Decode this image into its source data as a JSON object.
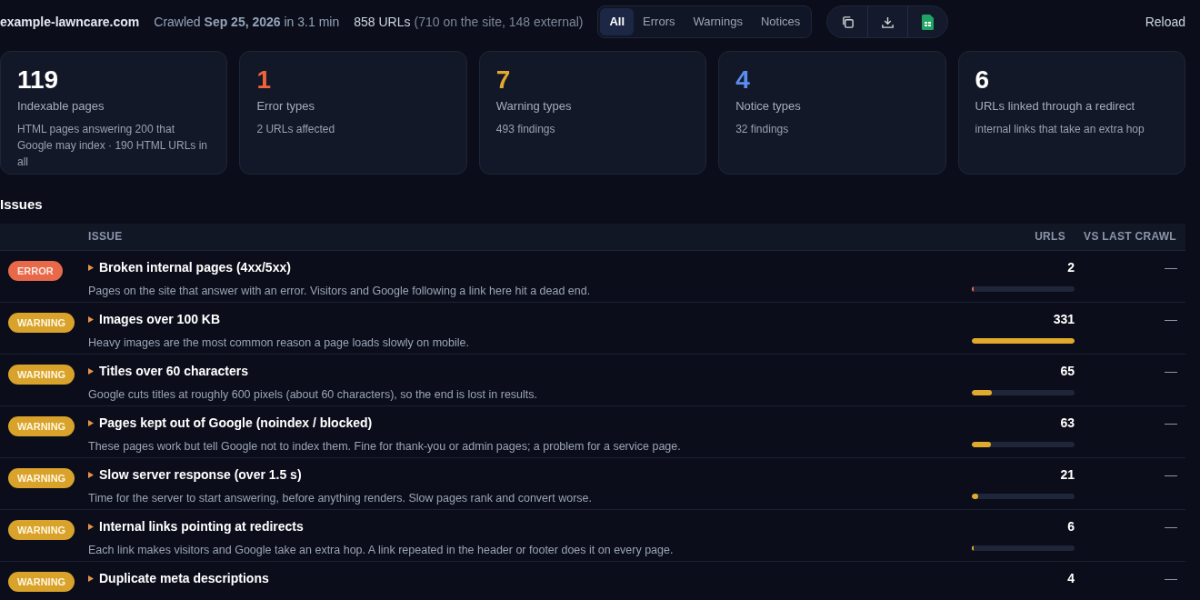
{
  "header": {
    "site": "example-lawncare.com",
    "crawled": "Crawled **Sep 25, 2026** in 3.1 min",
    "url_count": "858 URLs",
    "url_detail": "(710 on the site, 148 external)"
  },
  "filters": [
    {
      "label": "All",
      "selected": true
    },
    {
      "label": "Errors",
      "selected": false
    },
    {
      "label": "Warnings",
      "selected": false
    },
    {
      "label": "Notices",
      "selected": false
    }
  ],
  "actions": [
    {
      "kind": "copy"
    },
    {
      "kind": "download"
    },
    {
      "kind": "sheet"
    }
  ],
  "reload": "Reload",
  "cards": [
    {
      "kind": "neutral",
      "value": "119",
      "label": "Indexable pages",
      "detail": "HTML pages answering 200 that Google may index · 190 HTML URLs in all"
    },
    {
      "kind": "error",
      "value": "1",
      "label": "Error types",
      "detail": "2 URLs affected"
    },
    {
      "kind": "warning",
      "value": "7",
      "label": "Warning types",
      "detail": "493 findings"
    },
    {
      "kind": "notice",
      "value": "4",
      "label": "Notice types",
      "detail": "32 findings"
    },
    {
      "kind": "neutral",
      "value": "6",
      "label": "URLs linked through a redirect",
      "detail": "internal links that take an extra hop"
    }
  ],
  "issues": {
    "title": "Issues",
    "columns": [
      "ISSUE",
      "URLS",
      "VS LAST CRAWL"
    ],
    "rows": [
      {
        "kind": "error",
        "severity": "ERROR",
        "title": "Broken internal pages (4xx/5xx)",
        "description": "Pages on the site that answer with an error. Visitors and Google following a link here hit a dead end.",
        "urls": "2",
        "level": 0.006,
        "change": "—"
      },
      {
        "kind": "warning",
        "severity": "WARNING",
        "title": "Images over 100 KB",
        "description": "Heavy images are the most common reason a page loads slowly on mobile.",
        "urls": "331",
        "level": 1,
        "change": "—"
      },
      {
        "kind": "warning",
        "severity": "WARNING",
        "title": "Titles over 60 characters",
        "description": "Google cuts titles at roughly 600 pixels (about 60 characters), so the end is lost in results.",
        "urls": "65",
        "level": 0.196,
        "change": "—"
      },
      {
        "kind": "warning",
        "severity": "WARNING",
        "title": "Pages kept out of Google (noindex / blocked)",
        "description": "These pages work but tell Google not to index them. Fine for thank-you or admin pages; a problem for a service page.",
        "urls": "63",
        "level": 0.19,
        "change": "—"
      },
      {
        "kind": "warning",
        "severity": "WARNING",
        "title": "Slow server response (over 1.5 s)",
        "description": "Time for the server to start answering, before anything renders. Slow pages rank and convert worse.",
        "urls": "21",
        "level": 0.063,
        "change": "—"
      },
      {
        "kind": "warning",
        "severity": "WARNING",
        "title": "Internal links pointing at redirects",
        "description": "Each link makes visitors and Google take an extra hop. A link repeated in the header or footer does it on every page.",
        "urls": "6",
        "level": 0.018,
        "change": "—"
      },
      {
        "kind": "warning",
        "severity": "WARNING",
        "title": "Duplicate meta descriptions",
        "urls": "4",
        "change": "—"
      }
    ]
  }
}
